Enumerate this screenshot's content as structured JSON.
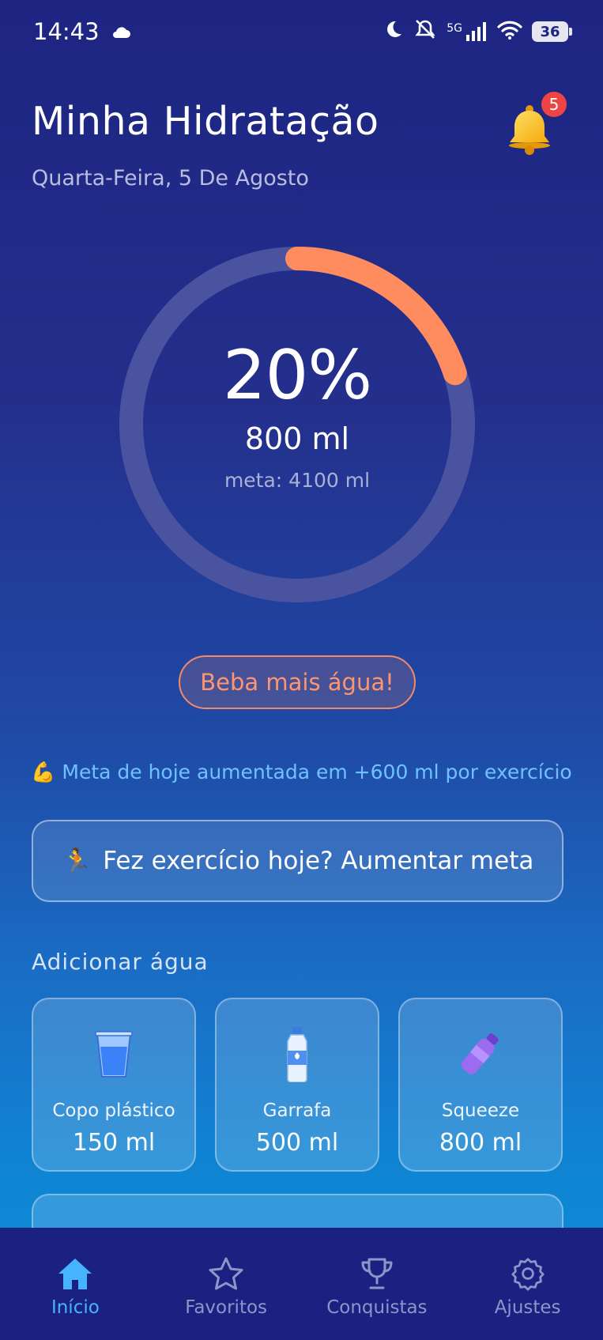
{
  "status_bar": {
    "time": "14:43",
    "network": "5G",
    "battery": "36"
  },
  "header": {
    "title": "Minha Hidratação",
    "date": "Quarta-Feira, 5 De Agosto",
    "notification_count": "5"
  },
  "progress": {
    "percent_label": "20%",
    "percent_value": 20,
    "consumed": "800 ml",
    "goal": "meta: 4100 ml"
  },
  "reminder_pill": "Beba mais água!",
  "goal_boost_note": "💪 Meta de hoje aumentada em +600 ml por exercício",
  "exercise_button": {
    "icon": "🏃",
    "label": "Fez exercício hoje? Aumentar meta"
  },
  "add_water": {
    "section_title": "Adicionar água",
    "options": [
      {
        "icon": "plastic-cup-icon",
        "label": "Copo plástico",
        "amount": "150 ml"
      },
      {
        "icon": "bottle-icon",
        "label": "Garrafa",
        "amount": "500 ml"
      },
      {
        "icon": "squeeze-bottle-icon",
        "label": "Squeeze",
        "amount": "800 ml"
      }
    ]
  },
  "bottom_nav": {
    "items": [
      {
        "icon": "home-icon",
        "label": "Início",
        "active": true
      },
      {
        "icon": "star-icon",
        "label": "Favoritos",
        "active": false
      },
      {
        "icon": "trophy-icon",
        "label": "Conquistas",
        "active": false
      },
      {
        "icon": "gear-icon",
        "label": "Ajustes",
        "active": false
      }
    ]
  },
  "colors": {
    "progress_arc": "#ff8c5e",
    "ring_track": "#4a53a0",
    "nav_active": "#46b3ff",
    "nav_inactive": "#8f95c8"
  }
}
